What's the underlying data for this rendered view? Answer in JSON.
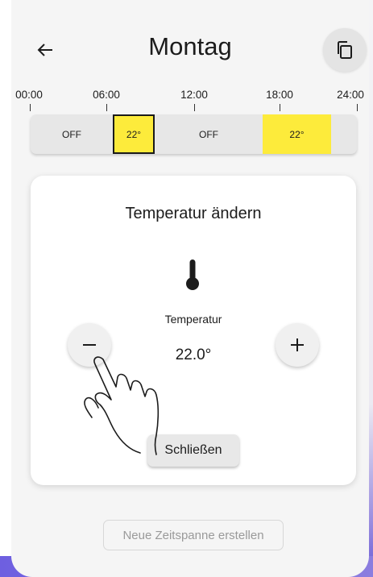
{
  "header": {
    "title": "Montag",
    "back_icon": "arrow-left-icon",
    "copy_icon": "copy-icon"
  },
  "timeline": {
    "ticks": [
      "00:00",
      "06:00",
      "12:00",
      "18:00",
      "24:00"
    ]
  },
  "schedule": {
    "segments": [
      {
        "label": "OFF",
        "state": "off"
      },
      {
        "label": "22°",
        "state": "on",
        "selected": true
      },
      {
        "label": "OFF",
        "state": "off"
      },
      {
        "label": "22°",
        "state": "on",
        "selected": false
      }
    ],
    "colors": {
      "on": "#fdeb3b",
      "off": "#e7e7e7",
      "selected_border": "#1a1a1a"
    }
  },
  "dialog": {
    "title": "Temperatur ändern",
    "icon": "thermometer-icon",
    "temperature_label": "Temperatur",
    "temperature_value": "22.0°",
    "decrease_icon": "minus-icon",
    "increase_icon": "plus-icon",
    "close_label": "Schließen"
  },
  "footer": {
    "new_timespan_label": "Neue Zeitspanne erstellen"
  }
}
